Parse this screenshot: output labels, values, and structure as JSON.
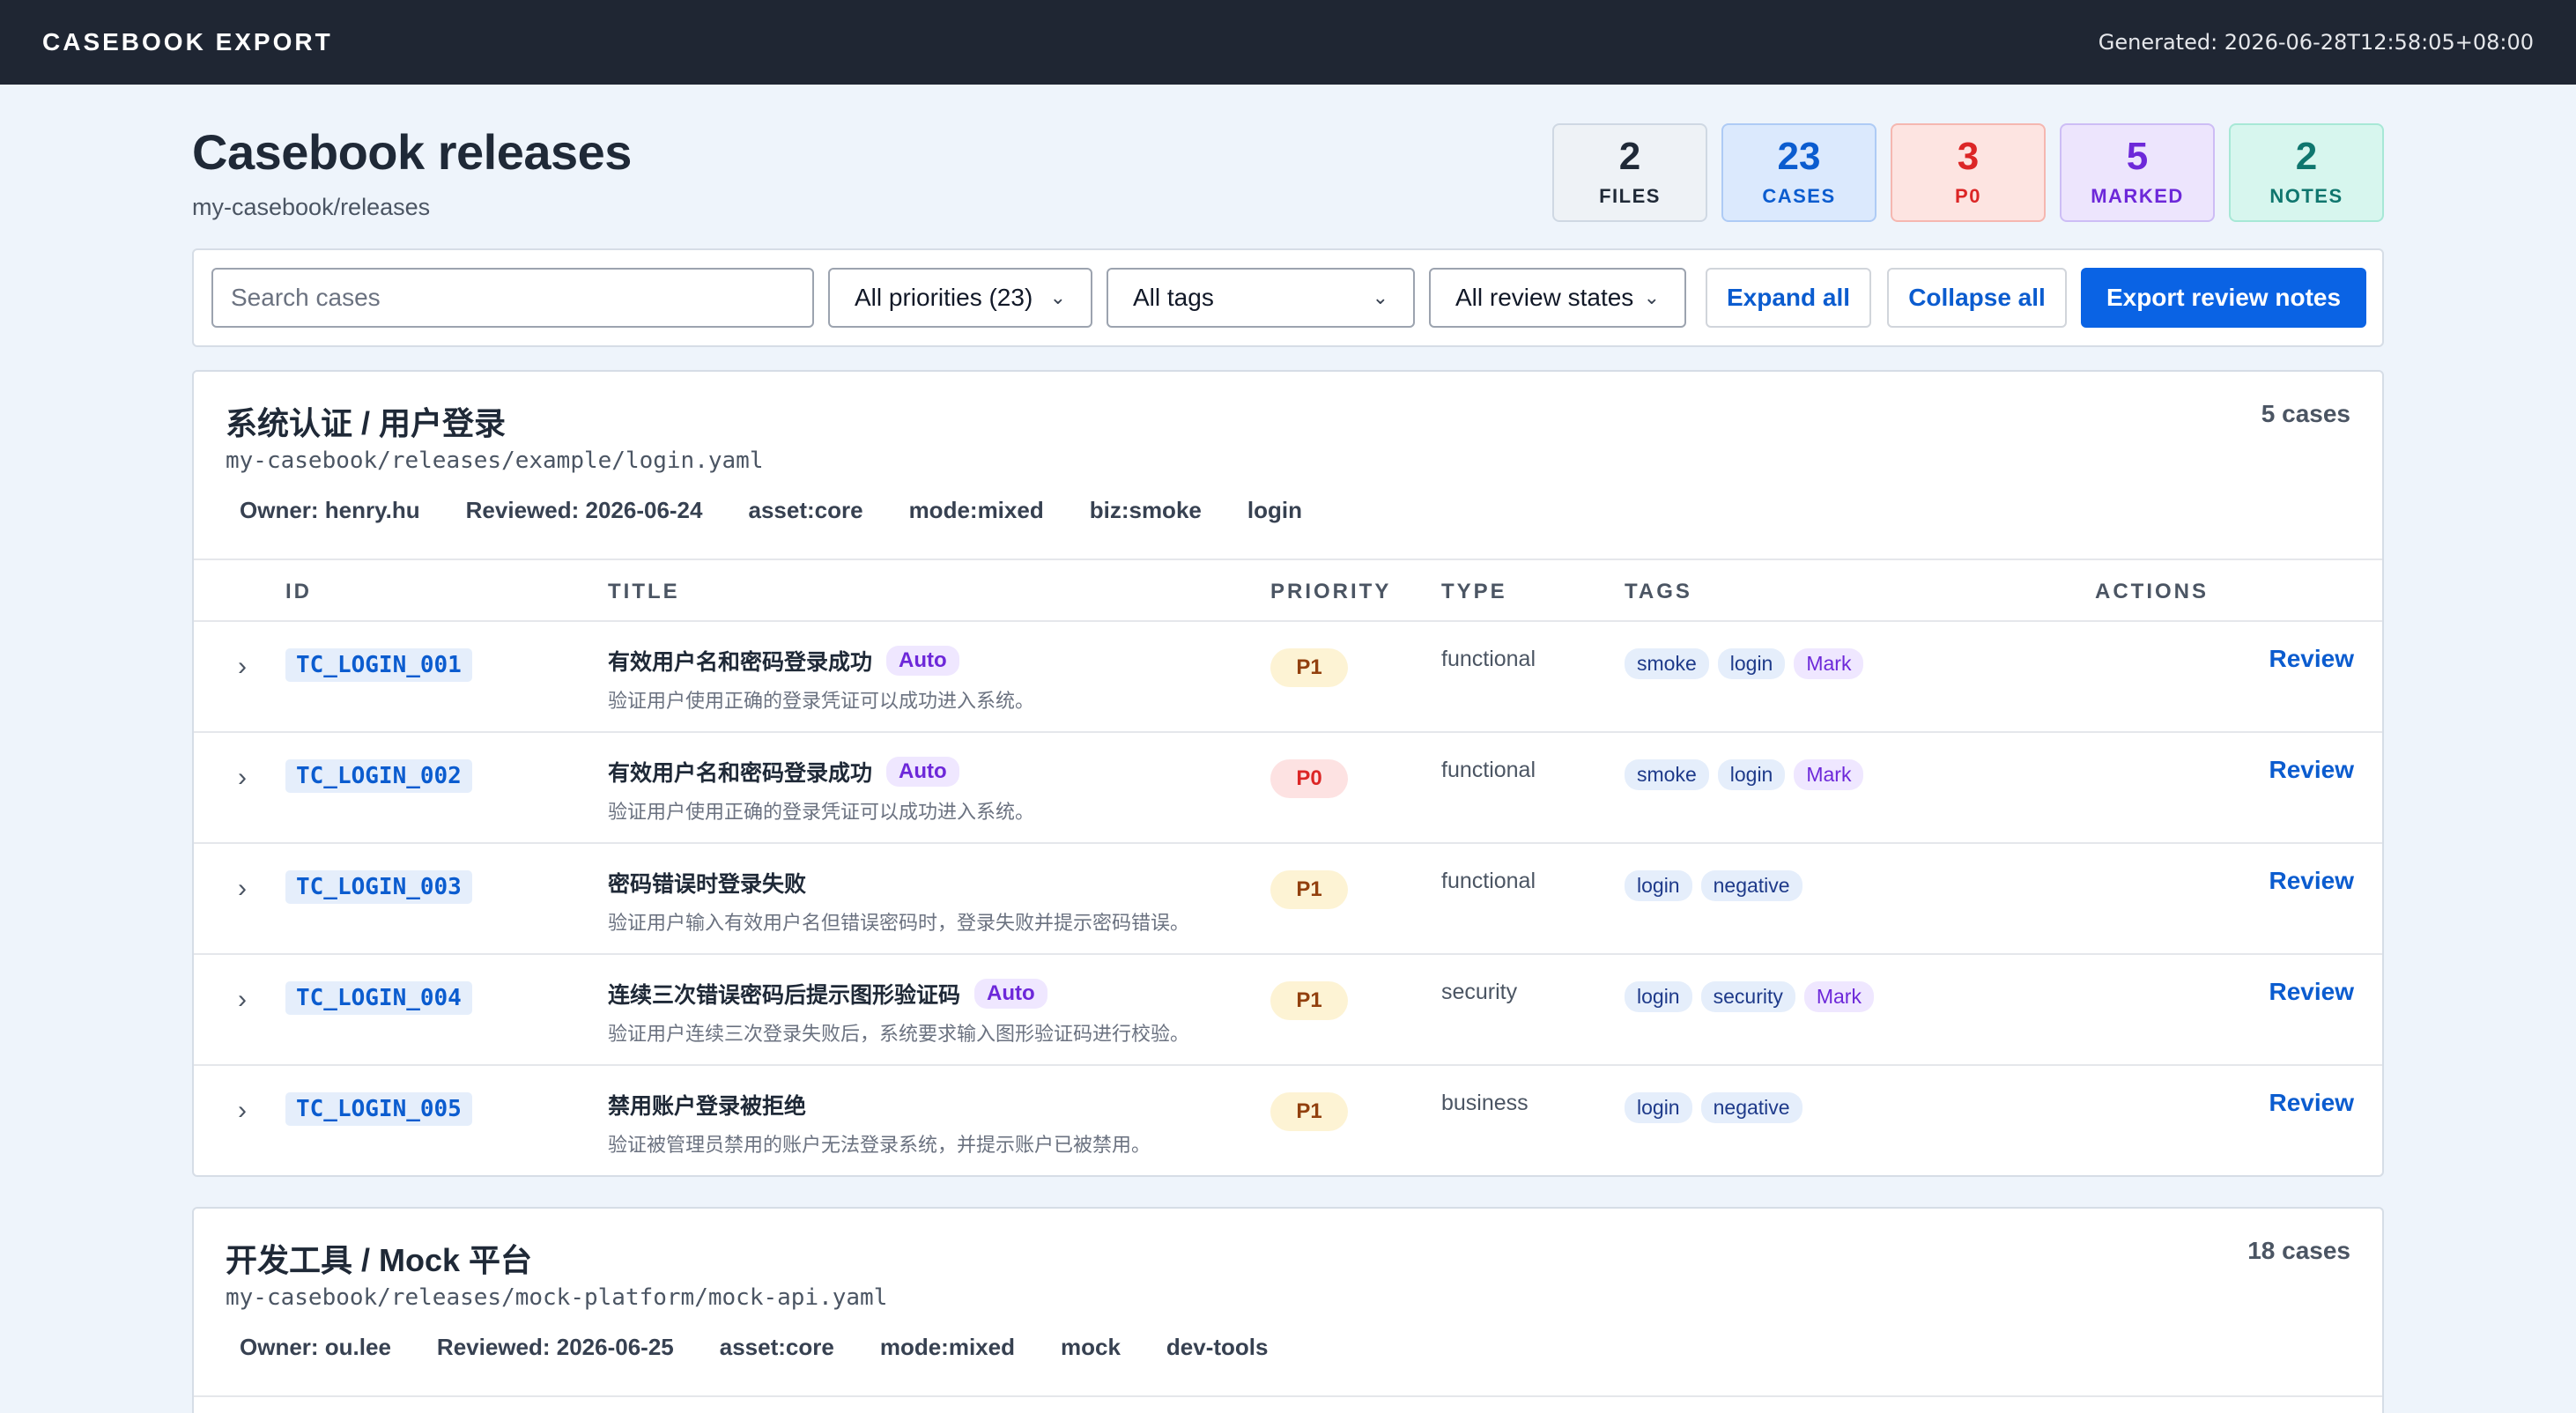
{
  "topbar": {
    "brand": "CASEBOOK EXPORT",
    "generated": "Generated: 2026-06-28T12:58:05+08:00"
  },
  "header": {
    "title": "Casebook releases",
    "subtitle": "my-casebook/releases"
  },
  "stats": [
    {
      "value": "2",
      "label": "FILES",
      "color": "#1f2937",
      "bg": "#eef2f6",
      "border": "#cfd8e3"
    },
    {
      "value": "23",
      "label": "CASES",
      "color": "#0b5ccf",
      "bg": "#dbe9fd",
      "border": "#aecbf5"
    },
    {
      "value": "3",
      "label": "P0",
      "color": "#dc2626",
      "bg": "#fde4e1",
      "border": "#f5b7b0"
    },
    {
      "value": "5",
      "label": "MARKED",
      "color": "#6d28d9",
      "bg": "#ede5fd",
      "border": "#cdbdf5"
    },
    {
      "value": "2",
      "label": "NOTES",
      "color": "#0f766e",
      "bg": "#d7f6ee",
      "border": "#a7e8d6"
    }
  ],
  "toolbar": {
    "search_placeholder": "Search cases",
    "priority_select": "All priorities (23)",
    "tags_select": "All tags",
    "review_select": "All review states",
    "expand_label": "Expand all",
    "collapse_label": "Collapse all",
    "export_label": "Export review notes"
  },
  "table_headers": {
    "id": "ID",
    "title": "TITLE",
    "priority": "PRIORITY",
    "type": "TYPE",
    "tags": "TAGS",
    "actions": "ACTIONS"
  },
  "files": [
    {
      "title": "系统认证 / 用户登录",
      "path": "my-casebook/releases/example/login.yaml",
      "count": "5 cases",
      "meta": [
        "Owner: henry.hu",
        "Reviewed: 2026-06-24",
        "asset:core",
        "mode:mixed",
        "biz:smoke",
        "login"
      ],
      "cases": [
        {
          "id": "TC_LOGIN_001",
          "title": "有效用户名和密码登录成功",
          "auto": "Auto",
          "desc": "验证用户使用正确的登录凭证可以成功进入系统。",
          "priority": "P1",
          "type": "functional",
          "tags": [
            "smoke",
            "login"
          ],
          "mark": "Mark",
          "action": "Review"
        },
        {
          "id": "TC_LOGIN_002",
          "title": "有效用户名和密码登录成功",
          "auto": "Auto",
          "desc": "验证用户使用正确的登录凭证可以成功进入系统。",
          "priority": "P0",
          "type": "functional",
          "tags": [
            "smoke",
            "login"
          ],
          "mark": "Mark",
          "action": "Review"
        },
        {
          "id": "TC_LOGIN_003",
          "title": "密码错误时登录失败",
          "auto": "",
          "desc": "验证用户输入有效用户名但错误密码时，登录失败并提示密码错误。",
          "priority": "P1",
          "type": "functional",
          "tags": [
            "login",
            "negative"
          ],
          "mark": "",
          "action": "Review"
        },
        {
          "id": "TC_LOGIN_004",
          "title": "连续三次错误密码后提示图形验证码",
          "auto": "Auto",
          "desc": "验证用户连续三次登录失败后，系统要求输入图形验证码进行校验。",
          "priority": "P1",
          "type": "security",
          "tags": [
            "login",
            "security"
          ],
          "mark": "Mark",
          "action": "Review"
        },
        {
          "id": "TC_LOGIN_005",
          "title": "禁用账户登录被拒绝",
          "auto": "",
          "desc": "验证被管理员禁用的账户无法登录系统，并提示账户已被禁用。",
          "priority": "P1",
          "type": "business",
          "tags": [
            "login",
            "negative"
          ],
          "mark": "",
          "action": "Review"
        }
      ]
    },
    {
      "title": "开发工具 / Mock 平台",
      "path": "my-casebook/releases/mock-platform/mock-api.yaml",
      "count": "18 cases",
      "meta": [
        "Owner: ou.lee",
        "Reviewed: 2026-06-25",
        "asset:core",
        "mode:mixed",
        "mock",
        "dev-tools"
      ],
      "cases": []
    }
  ]
}
